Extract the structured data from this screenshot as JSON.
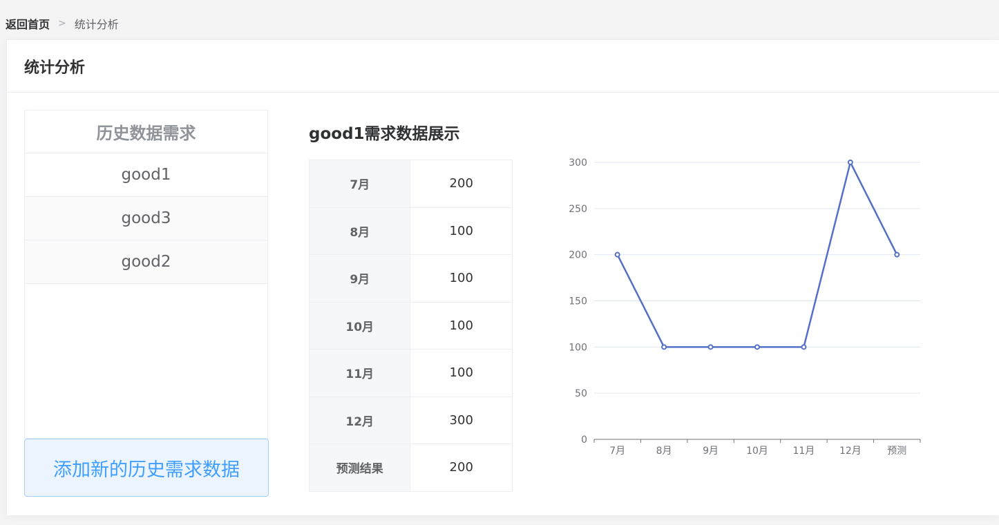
{
  "breadcrumb": {
    "home": "返回首页",
    "current": "统计分析"
  },
  "card": {
    "title": "统计分析"
  },
  "history_list": {
    "header": "历史数据需求",
    "items": [
      "good1",
      "good3",
      "good2"
    ],
    "add_button": "添加新的历史需求数据"
  },
  "detail": {
    "title": "good1需求数据展示",
    "rows": [
      {
        "label": "7月",
        "value": "200"
      },
      {
        "label": "8月",
        "value": "100"
      },
      {
        "label": "9月",
        "value": "100"
      },
      {
        "label": "10月",
        "value": "100"
      },
      {
        "label": "11月",
        "value": "100"
      },
      {
        "label": "12月",
        "value": "300"
      },
      {
        "label": "预测结果",
        "value": "200"
      }
    ]
  },
  "chart_data": {
    "type": "line",
    "categories": [
      "7月",
      "8月",
      "9月",
      "10月",
      "11月",
      "12月",
      "预测"
    ],
    "values": [
      200,
      100,
      100,
      100,
      100,
      300,
      200
    ],
    "ylim": [
      0,
      300
    ],
    "yticks": [
      0,
      50,
      100,
      150,
      200,
      250,
      300
    ],
    "grid": true,
    "line_color": "#5470c6"
  }
}
